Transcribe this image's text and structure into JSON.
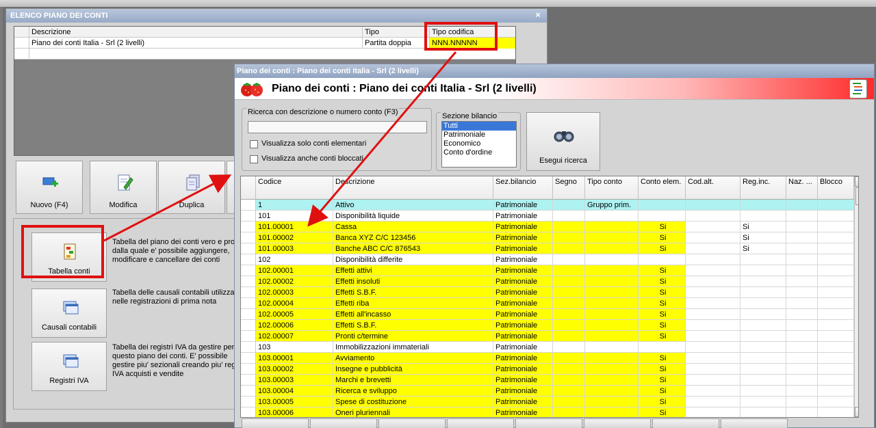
{
  "win1": {
    "title": "ELENCO PIANO DEI CONTI",
    "close": "×",
    "grid": {
      "headers": [
        "Descrizione",
        "Tipo",
        "Tipo codifica"
      ],
      "row": [
        "Piano dei conti Italia - Srl (2 livelli)",
        "Partita doppia",
        "NNN.NNNNN"
      ]
    },
    "buttons": {
      "nuovo": "Nuovo (F4)",
      "modifica": "Modifica",
      "duplica": "Duplica"
    },
    "tools": [
      {
        "label": "Tabella conti",
        "desc": "Tabella del piano dei conti vero e proprio dalla quale e' possibile aggiungere, modificare e cancellare dei conti"
      },
      {
        "label": "Causali contabili",
        "desc": "Tabella delle causali contabili utilizzate nelle registrazioni di prima nota"
      },
      {
        "label": "Registri IVA",
        "desc": "Tabella dei registri IVA da gestire per questo piano dei conti. E' possibile gestire piu' sezionali creando piu' registri IVA acquisti e vendite"
      }
    ]
  },
  "win2": {
    "title": "Piano dei conti : Piano dei conti Italia - Srl (2 livelli)",
    "banner_title": "Piano dei conti : Piano dei conti Italia - Srl (2 livelli)",
    "search": {
      "group_title": "Ricerca con descrizione o numero conto (F3)",
      "value": "",
      "chk_elementari": "Visualizza solo conti elementari",
      "chk_bloccati": "Visualizza anche conti bloccati"
    },
    "sezione": {
      "group_title": "Sezione bilancio",
      "options": [
        "Tutti",
        "Patrimoniale",
        "Economico",
        "Conto d'ordine"
      ],
      "selected": "Tutti"
    },
    "search_button": "Esegui ricerca",
    "grid": {
      "headers": [
        "Codice",
        "Descrizione",
        "Sez.bilancio",
        "Segno",
        "Tipo conto",
        "Conto elem.",
        "Cod.alt.",
        "Reg.inc.",
        "Naz. ...",
        "Blocco"
      ],
      "rows": [
        {
          "codice": "1",
          "descrizione": "Attivo",
          "sez": "Patrimoniale",
          "segno": "",
          "tipo": "Gruppo prim.",
          "elem": "",
          "codalt": "",
          "reginc": "",
          "naz": "",
          "blocco": "",
          "style": "cyan"
        },
        {
          "codice": "101",
          "descrizione": "Disponibilità liquide",
          "sez": "Patrimoniale",
          "segno": "",
          "tipo": "",
          "elem": "",
          "codalt": "",
          "reginc": "",
          "naz": "",
          "blocco": "",
          "style": "white"
        },
        {
          "codice": "101.00001",
          "descrizione": "Cassa",
          "sez": "Patrimoniale",
          "segno": "",
          "tipo": "",
          "elem": "Si",
          "codalt": "",
          "reginc": "Si",
          "naz": "",
          "blocco": "",
          "style": "yellow"
        },
        {
          "codice": "101.00002",
          "descrizione": "Banca XYZ C/C 123456",
          "sez": "Patrimoniale",
          "segno": "",
          "tipo": "",
          "elem": "Si",
          "codalt": "",
          "reginc": "Si",
          "naz": "",
          "blocco": "",
          "style": "yellow"
        },
        {
          "codice": "101.00003",
          "descrizione": "Banche ABC C/C 876543",
          "sez": "Patrimoniale",
          "segno": "",
          "tipo": "",
          "elem": "Si",
          "codalt": "",
          "reginc": "Si",
          "naz": "",
          "blocco": "",
          "style": "yellow"
        },
        {
          "codice": "102",
          "descrizione": "Disponibilità differite",
          "sez": "Patrimoniale",
          "segno": "",
          "tipo": "",
          "elem": "",
          "codalt": "",
          "reginc": "",
          "naz": "",
          "blocco": "",
          "style": "white"
        },
        {
          "codice": "102.00001",
          "descrizione": "Effetti attivi",
          "sez": "Patrimoniale",
          "segno": "",
          "tipo": "",
          "elem": "Si",
          "codalt": "",
          "reginc": "",
          "naz": "",
          "blocco": "",
          "style": "yellow"
        },
        {
          "codice": "102.00002",
          "descrizione": "Effetti insoluti",
          "sez": "Patrimoniale",
          "segno": "",
          "tipo": "",
          "elem": "Si",
          "codalt": "",
          "reginc": "",
          "naz": "",
          "blocco": "",
          "style": "yellow"
        },
        {
          "codice": "102.00003",
          "descrizione": "Effetti S.B.F.",
          "sez": "Patrimoniale",
          "segno": "",
          "tipo": "",
          "elem": "Si",
          "codalt": "",
          "reginc": "",
          "naz": "",
          "blocco": "",
          "style": "yellow"
        },
        {
          "codice": "102.00004",
          "descrizione": "Effetti riba",
          "sez": "Patrimoniale",
          "segno": "",
          "tipo": "",
          "elem": "Si",
          "codalt": "",
          "reginc": "",
          "naz": "",
          "blocco": "",
          "style": "yellow"
        },
        {
          "codice": "102.00005",
          "descrizione": "Effetti all'incasso",
          "sez": "Patrimoniale",
          "segno": "",
          "tipo": "",
          "elem": "Si",
          "codalt": "",
          "reginc": "",
          "naz": "",
          "blocco": "",
          "style": "yellow"
        },
        {
          "codice": "102.00006",
          "descrizione": "Effetti S.B.F.",
          "sez": "Patrimoniale",
          "segno": "",
          "tipo": "",
          "elem": "Si",
          "codalt": "",
          "reginc": "",
          "naz": "",
          "blocco": "",
          "style": "yellow"
        },
        {
          "codice": "102.00007",
          "descrizione": "Pronti c/termine",
          "sez": "Patrimoniale",
          "segno": "",
          "tipo": "",
          "elem": "Si",
          "codalt": "",
          "reginc": "",
          "naz": "",
          "blocco": "",
          "style": "yellow"
        },
        {
          "codice": "103",
          "descrizione": "Immobilizzazioni immateriali",
          "sez": "Patrimoniale",
          "segno": "",
          "tipo": "",
          "elem": "",
          "codalt": "",
          "reginc": "",
          "naz": "",
          "blocco": "",
          "style": "white"
        },
        {
          "codice": "103.00001",
          "descrizione": "Avviamento",
          "sez": "Patrimoniale",
          "segno": "",
          "tipo": "",
          "elem": "Si",
          "codalt": "",
          "reginc": "",
          "naz": "",
          "blocco": "",
          "style": "yellow"
        },
        {
          "codice": "103.00002",
          "descrizione": "Insegne e pubblicità",
          "sez": "Patrimoniale",
          "segno": "",
          "tipo": "",
          "elem": "Si",
          "codalt": "",
          "reginc": "",
          "naz": "",
          "blocco": "",
          "style": "yellow"
        },
        {
          "codice": "103.00003",
          "descrizione": "Marchi e brevetti",
          "sez": "Patrimoniale",
          "segno": "",
          "tipo": "",
          "elem": "Si",
          "codalt": "",
          "reginc": "",
          "naz": "",
          "blocco": "",
          "style": "yellow"
        },
        {
          "codice": "103.00004",
          "descrizione": "Ricerca e sviluppo",
          "sez": "Patrimoniale",
          "segno": "",
          "tipo": "",
          "elem": "Si",
          "codalt": "",
          "reginc": "",
          "naz": "",
          "blocco": "",
          "style": "yellow"
        },
        {
          "codice": "103.00005",
          "descrizione": "Spese di costituzione",
          "sez": "Patrimoniale",
          "segno": "",
          "tipo": "",
          "elem": "Si",
          "codalt": "",
          "reginc": "",
          "naz": "",
          "blocco": "",
          "style": "yellow"
        },
        {
          "codice": "103.00006",
          "descrizione": "Oneri pluriennali",
          "sez": "Patrimoniale",
          "segno": "",
          "tipo": "",
          "elem": "Si",
          "codalt": "",
          "reginc": "",
          "naz": "",
          "blocco": "",
          "style": "yellow"
        }
      ]
    }
  },
  "colors": {
    "yellow_row": "#ffff00",
    "cyan_row": "#aef2f2",
    "highlight_red": "#e01010",
    "selected_blue": "#3a78d8"
  }
}
